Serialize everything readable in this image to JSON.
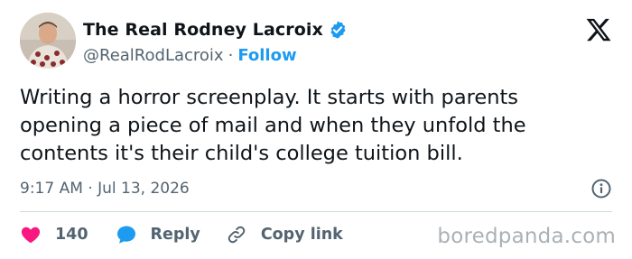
{
  "author": {
    "display_name": "The Real Rodney Lacroix",
    "handle": "@RealRodLacroix",
    "separator": "·",
    "follow_label": "Follow",
    "verified_icon": "verified-badge-icon",
    "avatar_icon": "profile-photo"
  },
  "tweet": {
    "lines": [
      "Writing a horror screenplay. It starts with parents",
      "opening a piece of mail and when they unfold the",
      "contents it's their child's college tuition bill."
    ],
    "timestamp": "9:17 AM · Jul 13, 2026"
  },
  "actions": {
    "like_count": "140",
    "reply_label": "Reply",
    "copy_link_label": "Copy link"
  },
  "watermark": "boredpanda.com",
  "colors": {
    "text": "#0f1419",
    "secondary": "#536471",
    "link_blue": "#1d9bf0",
    "heart_pink": "#f91880",
    "divider": "#cfd9de",
    "watermark": "#aab1b6"
  },
  "icons": {
    "brand": "x-logo-icon",
    "info": "info-icon",
    "like": "heart-icon",
    "reply": "speech-bubble-icon",
    "copy_link": "link-icon"
  }
}
